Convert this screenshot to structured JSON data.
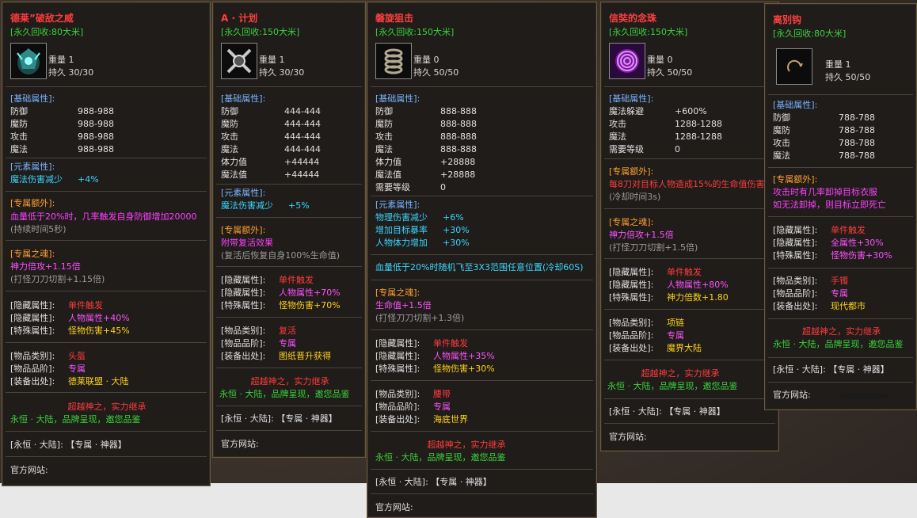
{
  "panels": [
    {
      "name": "德莱”破敌之威",
      "recycle": "[永久回收:80大米]",
      "weight": "重量  1",
      "durability": "持久  30/30",
      "basic_header": "[基础属性]:",
      "basic": [
        [
          "防御",
          "988-988"
        ],
        [
          "魔防",
          "988-988"
        ],
        [
          "攻击",
          "988-988"
        ],
        [
          "魔法",
          "988-988"
        ]
      ],
      "element_header": "[元素属性]:",
      "element": [
        [
          "魔法伤害减少",
          "+4%"
        ]
      ],
      "extra_header": "[专属额外]:",
      "extra": [
        "血量低于20%时，几率触发自身防御增加20000",
        "(持续时间5秒)"
      ],
      "soul_header": "[专属之魂]:",
      "soul": [
        "神力倍攻+1.15倍",
        "(打怪刀刀切割+1.15倍)"
      ],
      "hidden": [
        [
          "[隐藏属性]:",
          "单件触发"
        ],
        [
          "[隐藏属性]:",
          "人物属性+40%"
        ],
        [
          "[特殊属性]:",
          "怪物伤害+45%"
        ]
      ],
      "item": [
        [
          "[物品类别]:",
          "头盔"
        ],
        [
          "[物品品阶]:",
          "专属"
        ],
        [
          "[装备出处]:",
          "德莱联盟 · 大陆"
        ]
      ],
      "slogan1": "超越神之，实力继承",
      "slogan2": "永恒 · 大陆，品牌呈现，邀您品鉴",
      "footer1": "[永恒 · 大陆]:   【专属 · 神器】",
      "footer2": "官方网站:"
    },
    {
      "name": "A · 计划",
      "recycle": "[永久回收:150大米]",
      "weight": "重量  1",
      "durability": "持久  30/30",
      "basic_header": "[基础属性]:",
      "basic": [
        [
          "防御",
          "444-444"
        ],
        [
          "魔防",
          "444-444"
        ],
        [
          "攻击",
          "444-444"
        ],
        [
          "魔法",
          "444-444"
        ],
        [
          "体力值",
          "+44444"
        ],
        [
          "魔法值",
          "+44444"
        ]
      ],
      "element_header": "[元素属性]:",
      "element": [
        [
          "魔法伤害减少",
          "+5%"
        ]
      ],
      "extra_header": "[专属额外]:",
      "extra": [
        "附带复活效果",
        "(复活后恢复自身100%生命值)"
      ],
      "hidden": [
        [
          "[隐藏属性]:",
          "单件触发"
        ],
        [
          "[隐藏属性]:",
          "人物属性+70%"
        ],
        [
          "[特殊属性]:",
          "怪物伤害+70%"
        ]
      ],
      "item": [
        [
          "[物品类别]:",
          "复活"
        ],
        [
          "[物品品阶]:",
          "专属"
        ],
        [
          "[装备出处]:",
          "图纸晋升获得"
        ]
      ],
      "slogan1": "超越神之，实力继承",
      "slogan2": "永恒 · 大陆，品牌呈现，邀您品鉴",
      "footer1": "[永恒 · 大陆]:   【专属 · 神器】",
      "footer2": "官方网站:"
    },
    {
      "name": "磐旋狙击",
      "recycle": "[永久回收:150大米]",
      "weight": "重量  0",
      "durability": "持久  50/50",
      "basic_header": "[基础属性]:",
      "basic": [
        [
          "防御",
          "888-888"
        ],
        [
          "魔防",
          "888-888"
        ],
        [
          "攻击",
          "888-888"
        ],
        [
          "魔法",
          "888-888"
        ],
        [
          "体力值",
          "+28888"
        ],
        [
          "魔法值",
          "+28888"
        ],
        [
          "需要等级",
          "0"
        ]
      ],
      "element_header": "[元素属性]:",
      "element": [
        [
          "物理伤害减少",
          "+6%"
        ],
        [
          "增加目标暴率",
          "+30%"
        ],
        [
          "人物体力增加",
          "+30%"
        ]
      ],
      "special": "血量低于20%时随机飞至3X3范围任意位置(冷却60S)",
      "soul_header": "[专属之魂]:",
      "soul": [
        "生命值+1.5倍",
        "(打怪刀刀切割+1.3倍)"
      ],
      "hidden": [
        [
          "[隐藏属性]:",
          "单件触发"
        ],
        [
          "[隐藏属性]:",
          "人物属性+35%"
        ],
        [
          "[特殊属性]:",
          "怪物伤害+30%"
        ]
      ],
      "item": [
        [
          "[物品类别]:",
          "腰带"
        ],
        [
          "[物品品阶]:",
          "专属"
        ],
        [
          "[装备出处]:",
          "海底世界"
        ]
      ],
      "slogan1": "超越神之，实力继承",
      "slogan2": "永恒 · 大陆，品牌呈现，邀您品鉴",
      "footer1": "[永恒 · 大陆]:   【专属 · 神器】",
      "footer2": "官方网站:"
    },
    {
      "name": "信奘的念珠",
      "recycle": "[永久回收:150大米]",
      "weight": "重量  0",
      "durability": "持久  50/50",
      "basic_header": "[基础属性]:",
      "basic": [
        [
          "魔法躲避",
          "+600%"
        ],
        [
          "攻击",
          "1288-1288"
        ],
        [
          "魔法",
          "1288-1288"
        ],
        [
          "需要等级",
          "0"
        ]
      ],
      "extra_header": "[专属额外]:",
      "extra": [
        "每8刀对目标人物造成15%的生命值伤害",
        "(冷却时间3s)"
      ],
      "soul_header": "[专属之魂]:",
      "soul": [
        "神力倍攻+1.5倍",
        "(打怪刀刀切割+1.5倍)"
      ],
      "hidden": [
        [
          "[隐藏属性]:",
          "单件触发"
        ],
        [
          "[隐藏属性]:",
          "人物属性+80%"
        ],
        [
          "[特殊属性]:",
          "神力倍数+1.80"
        ]
      ],
      "item": [
        [
          "[物品类别]:",
          "项链"
        ],
        [
          "[物品品阶]:",
          "专属"
        ],
        [
          "[装备出处]:",
          "魔界大陆"
        ]
      ],
      "slogan1": "超越神之，实力继承",
      "slogan2": "永恒 · 大陆，品牌呈现，邀您品鉴",
      "footer1": "[永恒 · 大陆]:   【专属 · 神器】",
      "footer2": "官方网站:"
    },
    {
      "name": "离别钩",
      "recycle": "[永久回收:80大米]",
      "weight": "重量  1",
      "durability": "持久  50/50",
      "basic_header": "[基础属性]:",
      "basic": [
        [
          "防御",
          "788-788"
        ],
        [
          "魔防",
          "788-788"
        ],
        [
          "攻击",
          "788-788"
        ],
        [
          "魔法",
          "788-788"
        ]
      ],
      "extra_header": "[专属额外]:",
      "extra": [
        "攻击时有几率卸掉目标衣服",
        "如无法卸掉，则目标立即死亡"
      ],
      "hidden": [
        [
          "[隐藏属性]:",
          "单件触发"
        ],
        [
          "[隐藏属性]:",
          "全属性+30%"
        ],
        [
          "[特殊属性]:",
          "怪物伤害+30%"
        ]
      ],
      "item": [
        [
          "[物品类别]:",
          "手镯"
        ],
        [
          "[物品品阶]:",
          "专属"
        ],
        [
          "[装备出处]:",
          "现代都市"
        ]
      ],
      "slogan1": "超越神之，实力继承",
      "slogan2": "永恒 · 大陆，品牌呈现，邀您品鉴",
      "footer1": "[永恒 · 大陆]:   【专属 · 神器】",
      "footer2": "官方网站:"
    }
  ]
}
